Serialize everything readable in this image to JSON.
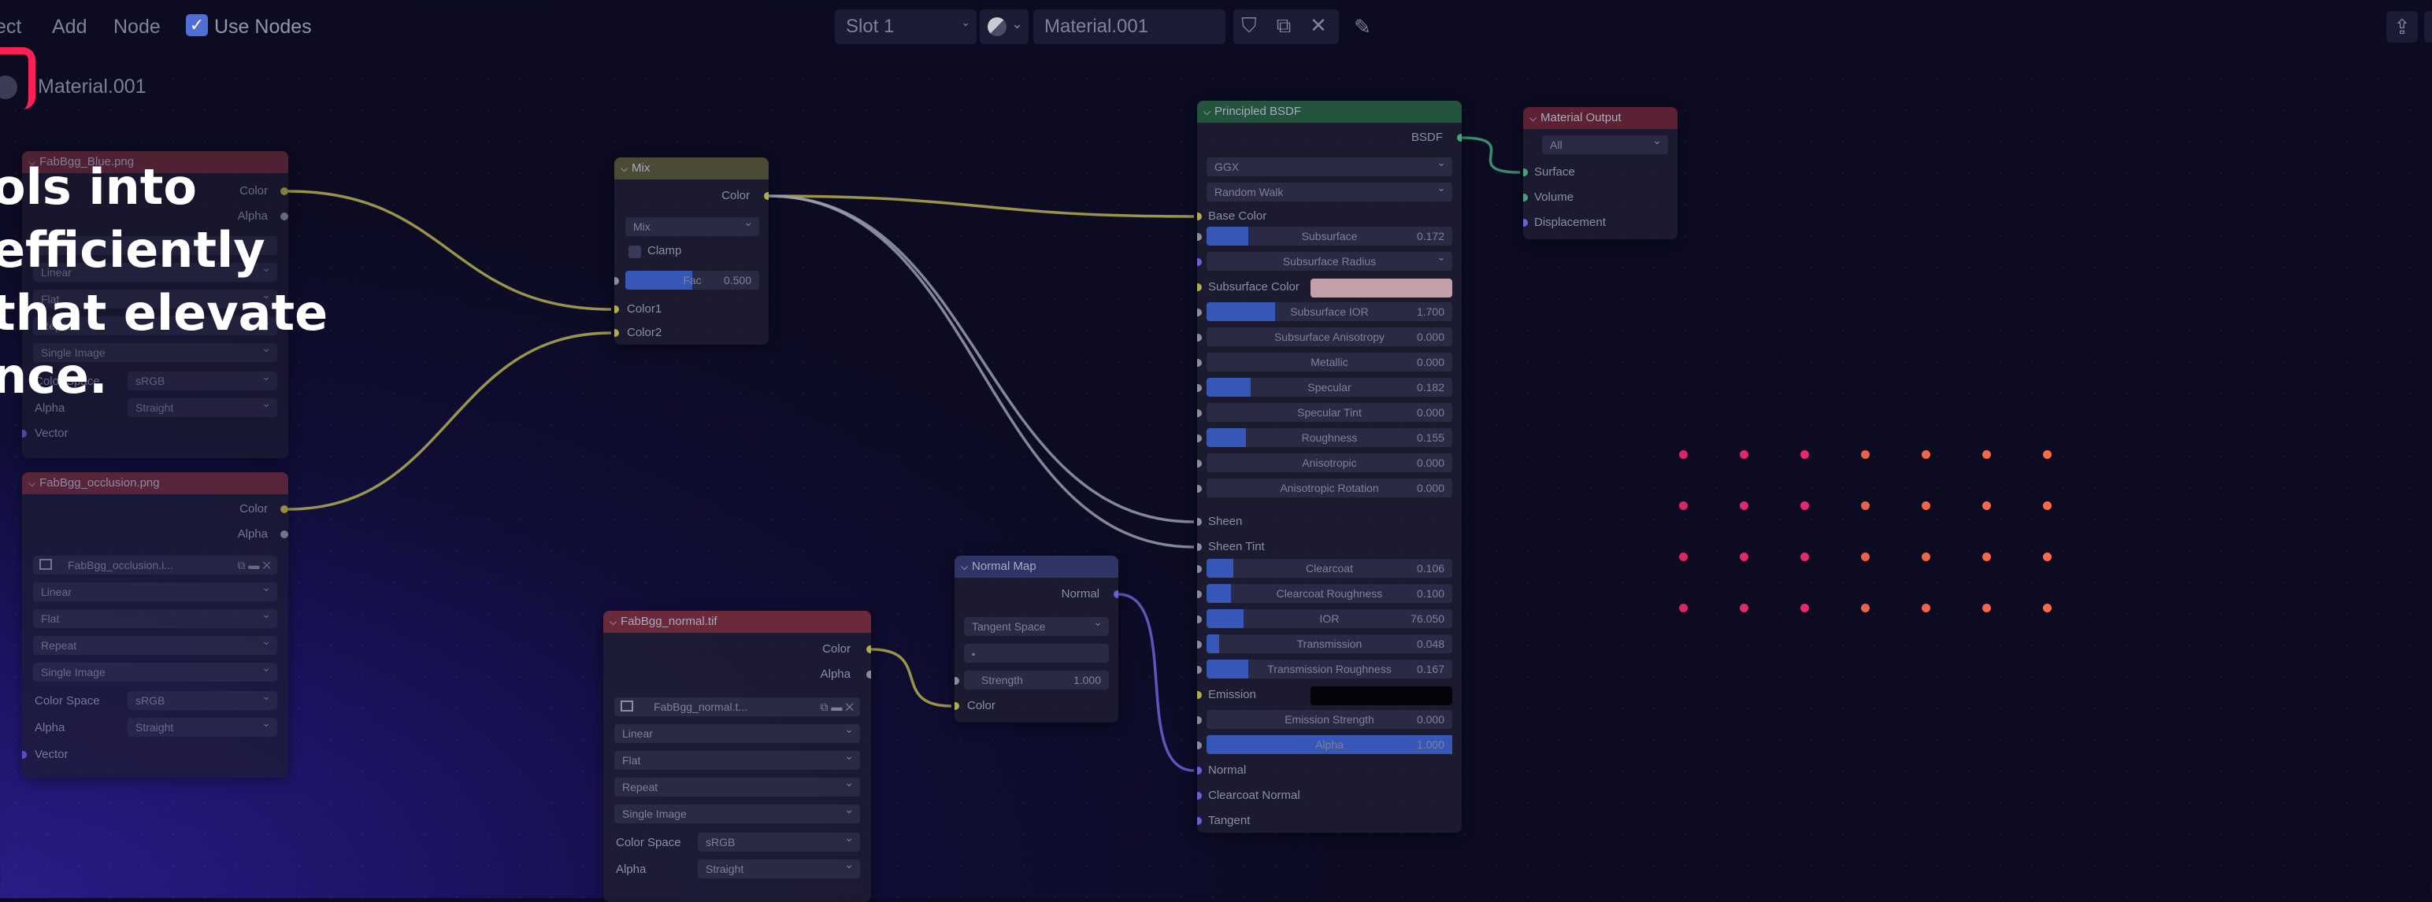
{
  "header": {
    "menu": [
      "ect",
      "Add",
      "Node"
    ],
    "use_nodes_label": "Use Nodes",
    "use_nodes_check": "✓",
    "slot": "Slot 1",
    "material_field": "Material.001",
    "icons": {
      "shield": "shield-icon",
      "copy": "copy-icon",
      "close": "close-icon",
      "pin": "pin-icon",
      "sphere": "material-sphere-icon",
      "export": "export-icon"
    }
  },
  "breadcrumb": {
    "material": "Material.001"
  },
  "headline": {
    "lines": [
      "ols into",
      "efficiently",
      "that elevate",
      "nce."
    ]
  },
  "nodes": {
    "tex1": {
      "title": "FabBgg_Blue.png",
      "outputs": [
        "Color",
        "Alpha"
      ],
      "rows": [
        "Linear",
        "Flat",
        "Repeat",
        "Single Image"
      ],
      "color_space_label": "Color Space",
      "color_space": "sRGB",
      "alpha_label": "Alpha",
      "alpha": "Straight",
      "vector": "Vector"
    },
    "tex2": {
      "title": "FabBgg_occlusion.png",
      "outputs": [
        "Color",
        "Alpha"
      ],
      "image_name": "FabBgg_occlusion.i...",
      "rows": [
        "Linear",
        "Flat",
        "Repeat",
        "Single Image"
      ],
      "color_space_label": "Color Space",
      "color_space": "sRGB",
      "alpha_label": "Alpha",
      "alpha": "Straight",
      "vector": "Vector"
    },
    "mix": {
      "title": "Mix",
      "out": "Color",
      "blend": "Mix",
      "clamp": "Clamp",
      "fac_label": "Fac",
      "fac_value": "0.500",
      "fac_level": 0.5,
      "in1": "Color1",
      "in2": "Color2"
    },
    "normal_tex": {
      "title": "FabBgg_normal.tif",
      "outputs": [
        "Color",
        "Alpha"
      ],
      "image_name": "FabBgg_normal.t...",
      "rows": [
        "Linear",
        "Flat",
        "Repeat",
        "Single Image"
      ],
      "color_space_label": "Color Space",
      "color_space": "sRGB",
      "alpha_label": "Alpha",
      "alpha": "Straight"
    },
    "normal_map": {
      "title": "Normal Map",
      "out": "Normal",
      "space": "Tangent Space",
      "strength_label": "Strength",
      "strength": "1.000",
      "in": "Color"
    },
    "bsdf": {
      "title": "Principled BSDF",
      "out": "BSDF",
      "distribution": "GGX",
      "subsurface_method": "Random Walk",
      "base_color": "Base Color",
      "sliders": [
        {
          "label": "Subsurface",
          "value": "0.172",
          "level": 0.17
        },
        {
          "label": "Subsurface Radius",
          "value": "",
          "level": 0
        },
        {
          "label": "Subsurface Color",
          "value": "",
          "level": 0
        },
        {
          "label": "Subsurface IOR",
          "value": "1.700",
          "level": 0.28
        },
        {
          "label": "Subsurface Anisotropy",
          "value": "0.000",
          "level": 0
        },
        {
          "label": "Metallic",
          "value": "0.000",
          "level": 0
        },
        {
          "label": "Specular",
          "value": "0.182",
          "level": 0.18
        },
        {
          "label": "Specular Tint",
          "value": "0.000",
          "level": 0
        },
        {
          "label": "Roughness",
          "value": "0.155",
          "level": 0.16
        },
        {
          "label": "Anisotropic",
          "value": "0.000",
          "level": 0
        },
        {
          "label": "Anisotropic Rotation",
          "value": "0.000",
          "level": 0
        }
      ],
      "sheen": "Sheen",
      "sheen_tint": "Sheen Tint",
      "sliders2": [
        {
          "label": "Clearcoat",
          "value": "0.106",
          "level": 0.11
        },
        {
          "label": "Clearcoat Roughness",
          "value": "0.100",
          "level": 0.1
        },
        {
          "label": "IOR",
          "value": "76.050",
          "level": 0.15
        },
        {
          "label": "Transmission",
          "value": "0.048",
          "level": 0.05
        },
        {
          "label": "Transmission Roughness",
          "value": "0.167",
          "level": 0.17
        }
      ],
      "emission": "Emission",
      "emission_strength": {
        "label": "Emission Strength",
        "value": "0.000"
      },
      "alpha": {
        "label": "Alpha",
        "value": "1.000",
        "level": 1.0
      },
      "normal": "Normal",
      "clearcoat_normal": "Clearcoat Normal",
      "tangent": "Tangent"
    },
    "output": {
      "title": "Material Output",
      "target": "All",
      "inputs": [
        "Surface",
        "Volume",
        "Displacement"
      ]
    }
  },
  "colors": {
    "accent": "#ff1f57",
    "wire_yellow": "#b3ad50",
    "wire_gray": "#9a9daa",
    "wire_purple": "#6e62d8",
    "wire_green": "#3fa57a",
    "dot_pink": "#ff2d6f",
    "dot_orange": "#ff6a4a",
    "subsurface_color": "#c3a0a8",
    "emission_color": "#05040a"
  },
  "decoration": {
    "dot_rows": 4,
    "dot_cols": 7
  }
}
